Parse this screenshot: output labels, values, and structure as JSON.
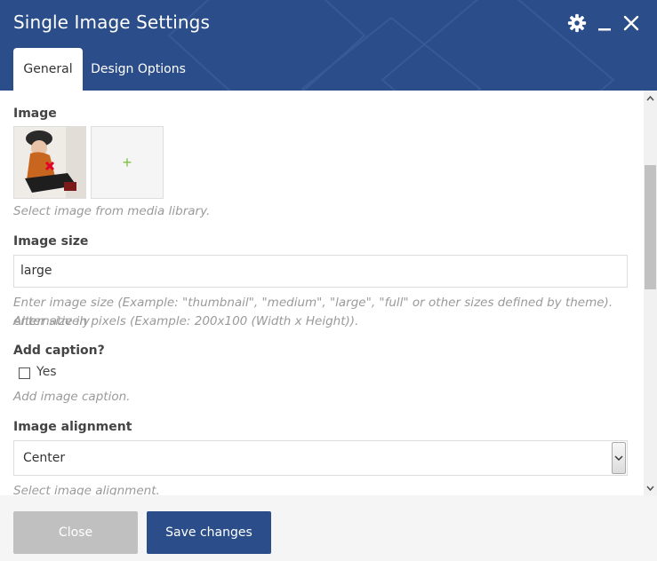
{
  "header": {
    "title": "Single Image Settings",
    "icons": [
      "gear-icon",
      "minimize-icon",
      "close-icon"
    ]
  },
  "tabs": [
    {
      "label": "General",
      "active": true
    },
    {
      "label": "Design Options",
      "active": false
    }
  ],
  "fields": {
    "image": {
      "label": "Image",
      "help": "Select image from media library.",
      "add_tile_icon": "+"
    },
    "image_size": {
      "label": "Image size",
      "value": "large",
      "help_line1": "Enter image size (Example: \"thumbnail\", \"medium\", \"large\", \"full\" or other sizes defined by theme). Alternatively",
      "help_line2": "enter size in pixels (Example: 200x100 (Width x Height))."
    },
    "add_caption": {
      "label": "Add caption?",
      "checkbox_label": "Yes",
      "checked": false,
      "help": "Add image caption."
    },
    "image_alignment": {
      "label": "Image alignment",
      "value": "Center",
      "help": "Select image alignment."
    }
  },
  "footer": {
    "close_label": "Close",
    "save_label": "Save changes"
  },
  "colors": {
    "header_bg": "#2b4e8a",
    "primary_button": "#2b4e8a",
    "close_button": "#c0c0c0",
    "add_plus": "#7ac142",
    "thumb_badge": "#e4002b"
  }
}
